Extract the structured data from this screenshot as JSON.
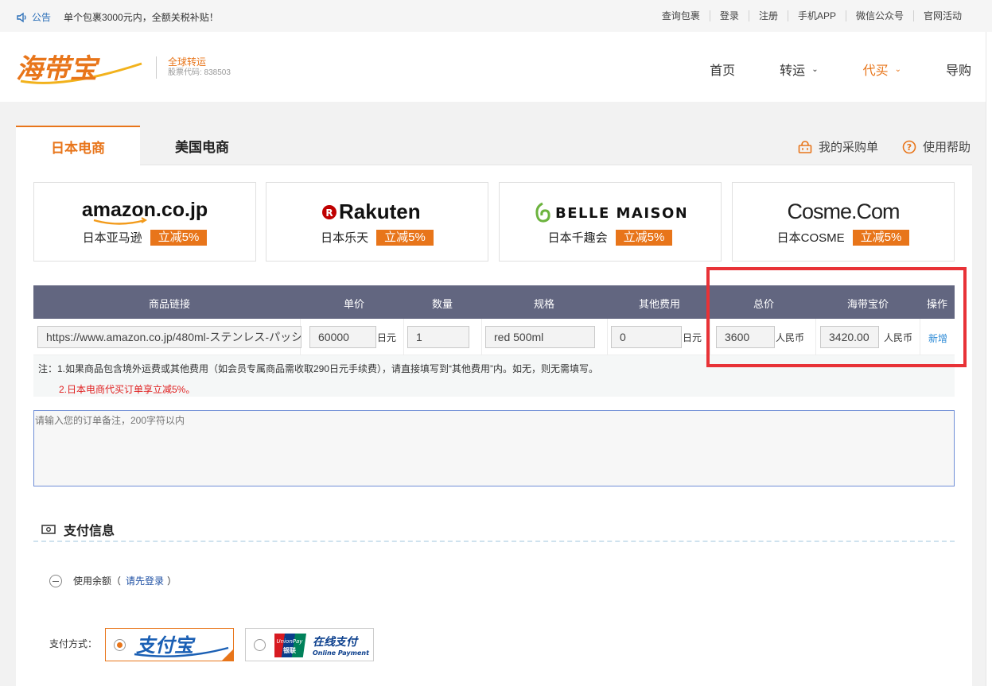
{
  "notice": {
    "label": "公告",
    "text": "单个包裹3000元内，全额关税补贴！"
  },
  "top_links": [
    "查询包裹",
    "登录",
    "注册",
    "手机APP",
    "微信公众号",
    "官网活动"
  ],
  "brand": {
    "name": "海带宝",
    "slogan": "全球转运",
    "stock_code": "股票代码: 838503"
  },
  "nav": [
    {
      "label": "首页",
      "dropdown": false,
      "active": false
    },
    {
      "label": "转运",
      "dropdown": true,
      "active": false
    },
    {
      "label": "代买",
      "dropdown": true,
      "active": true
    },
    {
      "label": "导购",
      "dropdown": false,
      "active": false
    }
  ],
  "tabs": {
    "active": "日本电商",
    "inactive": "美国电商"
  },
  "tools": {
    "cart": "我的采购单",
    "help": "使用帮助"
  },
  "stores": [
    {
      "logo_text": "amazon.co.jp",
      "name": "日本亚马逊",
      "discount": "立减5%"
    },
    {
      "logo_text": "Rakuten",
      "name": "日本乐天",
      "discount": "立减5%"
    },
    {
      "logo_text": "BELLE MAISON",
      "name": "日本千趣会",
      "discount": "立减5%"
    },
    {
      "logo_text": "Cosme.Com",
      "name": "日本COSME",
      "discount": "立减5%"
    }
  ],
  "table": {
    "headers": {
      "link": "商品链接",
      "price": "单价",
      "qty": "数量",
      "spec": "规格",
      "other": "其他费用",
      "total": "总价",
      "hdb_price": "海带宝价",
      "action": "操作"
    },
    "row": {
      "link": "https://www.amazon.co.jp/480ml-ステンレス-パッシ",
      "price": "60000",
      "price_unit": "日元",
      "qty": "1",
      "spec": "red 500ml",
      "other": "0",
      "other_unit": "日元",
      "total": "3600",
      "total_unit": "人民币",
      "hdb_price": "3420.00",
      "hdb_unit": "人民币",
      "action": "新增"
    }
  },
  "notes": {
    "line1": "注：1.如果商品包含境外运费或其他费用（如会员专属商品需收取290日元手续费），请直接填写到“其他费用”内。如无，则无需填写。",
    "line2": "2.日本电商代买订单享立减5%。"
  },
  "remark": {
    "placeholder": "请输入您的订单备注，200字符以内"
  },
  "payment": {
    "title": "支付信息",
    "balance_prefix": "使用余额（",
    "balance_login": "请先登录",
    "balance_suffix": "）",
    "method_label": "支付方式：",
    "alipay": "支付宝",
    "unionpay_cn": "在线支付",
    "unionpay_en": "Online Payment",
    "unionpay_badge_top": "UnionPay",
    "unionpay_badge_bottom": "银联"
  },
  "colors": {
    "accent": "#e8751a",
    "header_bg": "#626680",
    "highlight": "#e83237",
    "link": "#2b8ad6"
  }
}
